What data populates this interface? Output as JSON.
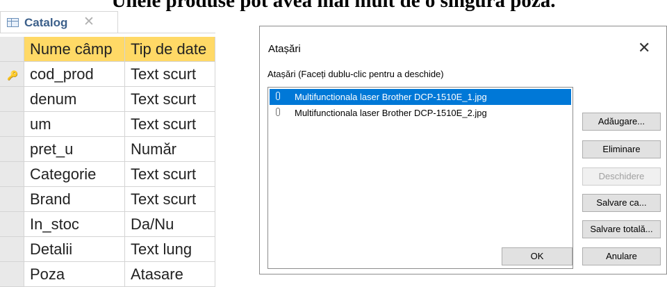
{
  "heading": "Unele produse pot avea mai mult de o singură poză.",
  "tab": {
    "label": "Catalog",
    "close": "✕"
  },
  "table": {
    "header": [
      "Nume câmp",
      "Tip de date"
    ],
    "rows": [
      [
        "cod_prod",
        "Text scurt"
      ],
      [
        "denum",
        "Text scurt"
      ],
      [
        "um",
        "Text scurt"
      ],
      [
        "pret_u",
        "Număr"
      ],
      [
        "Categorie",
        "Text scurt"
      ],
      [
        "Brand",
        "Text scurt"
      ],
      [
        "In_stoc",
        "Da/Nu"
      ],
      [
        "Detalii",
        "Text lung"
      ],
      [
        "Poza",
        "Atasare"
      ]
    ]
  },
  "dialog": {
    "title": "Atașări",
    "close": "✕",
    "list_label": "Atașări (Faceți dublu-clic pentru a deschide)",
    "files": [
      "Multifunctionala laser Brother DCP-1510E_1.jpg",
      "Multifunctionala laser Brother DCP-1510E_2.jpg"
    ],
    "buttons": {
      "add": "Adăugare...",
      "remove": "Eliminare",
      "open": "Deschidere",
      "save_as": "Salvare ca...",
      "save_all": "Salvare totală...",
      "ok": "OK",
      "cancel": "Anulare"
    }
  },
  "colors": {
    "header_fill": "#ffd966",
    "selection": "#0078d7"
  }
}
